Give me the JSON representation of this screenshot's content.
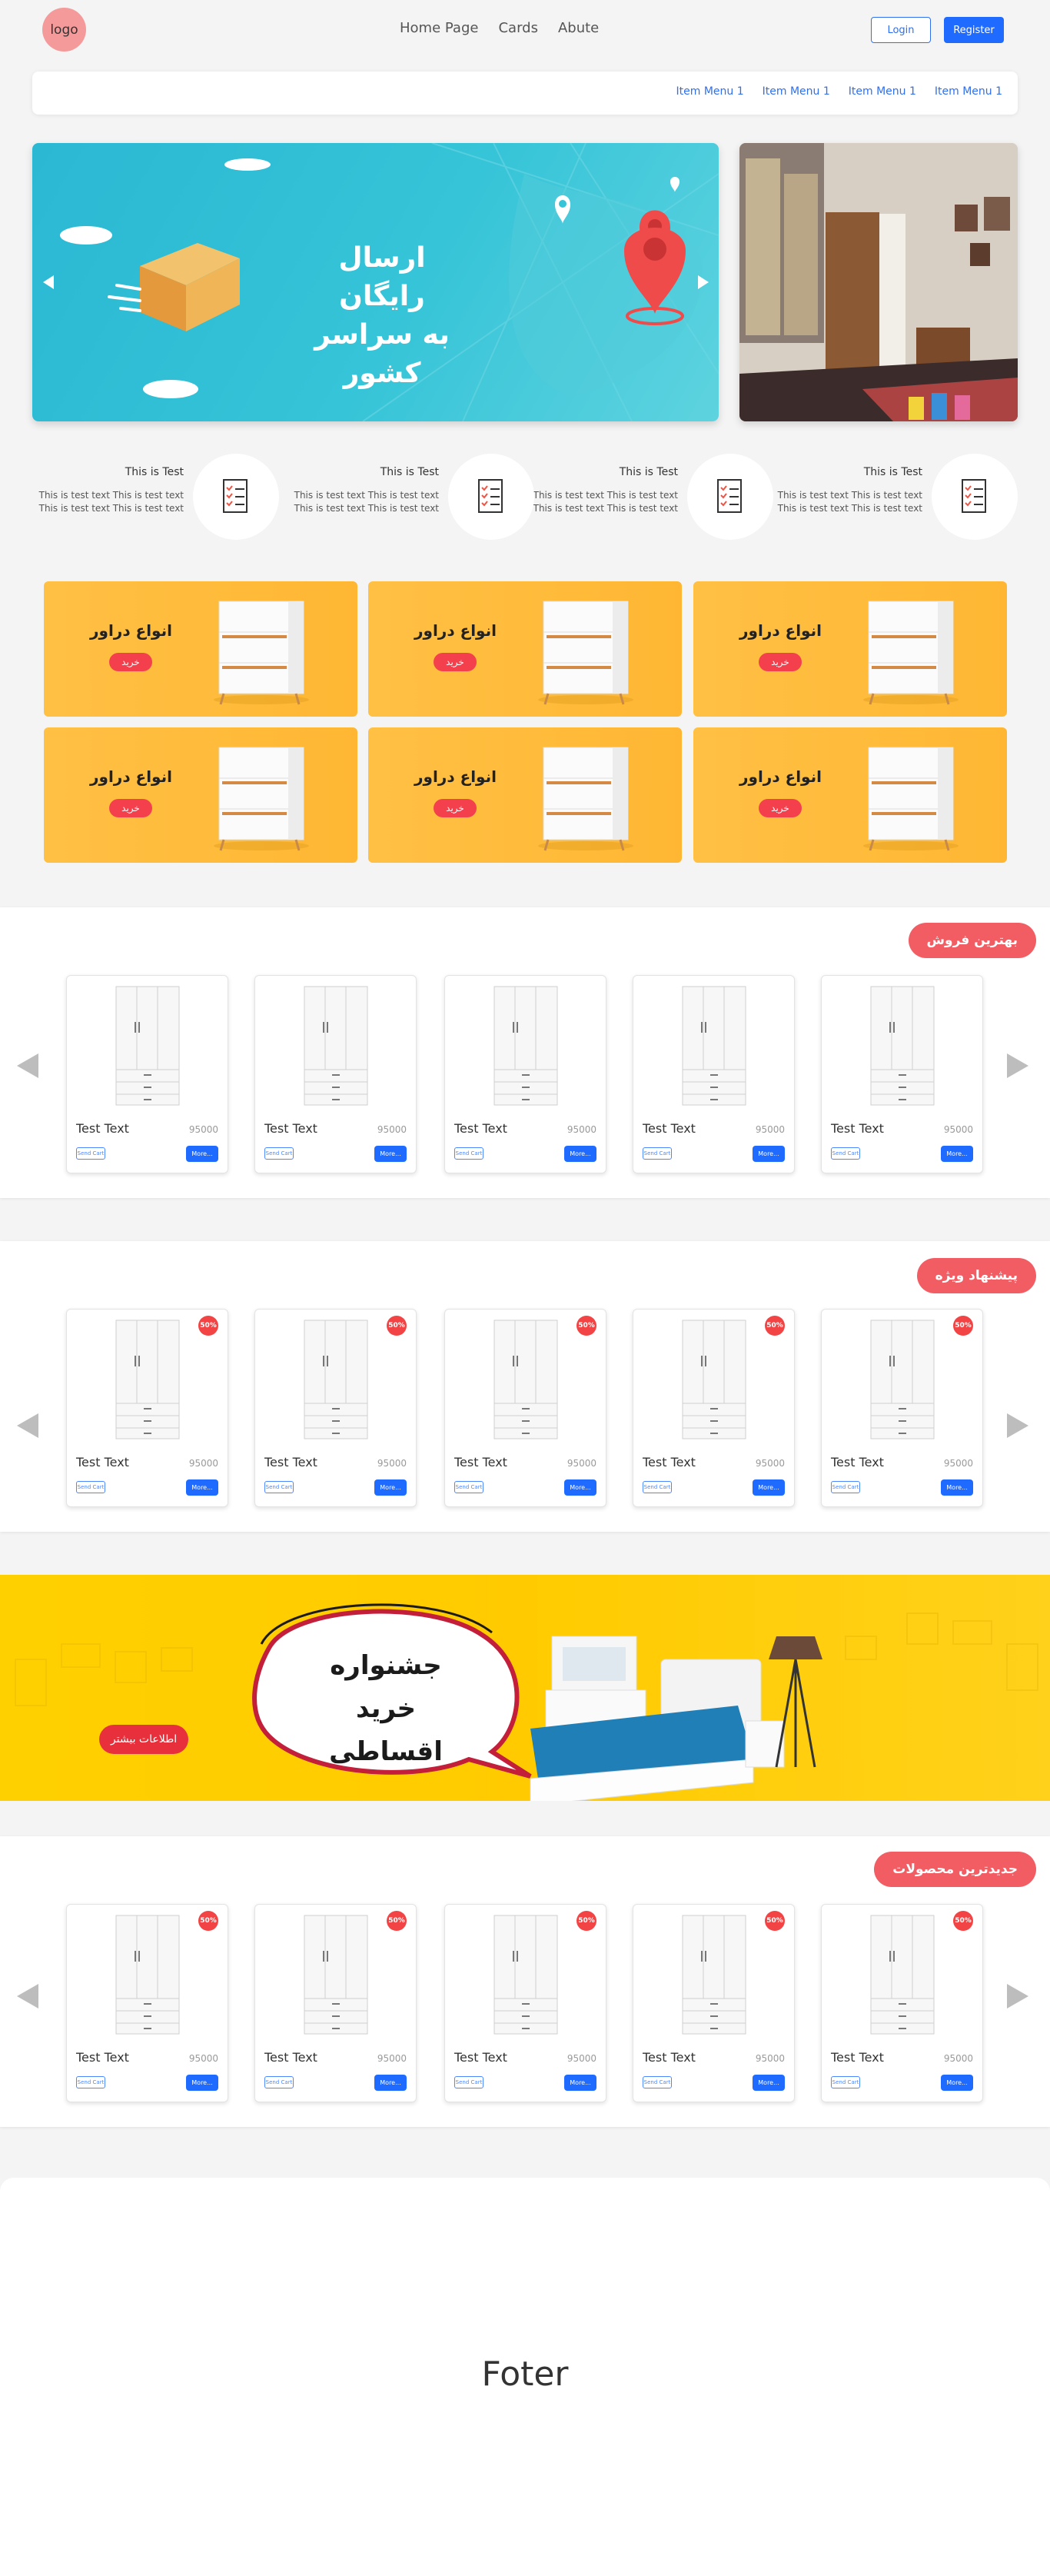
{
  "header": {
    "logo_text": "logo",
    "nav": [
      "Home Page",
      "Cards",
      "Abute"
    ],
    "login_label": "Login",
    "register_label": "Register"
  },
  "menu": [
    "Item Menu 1",
    "Item Menu 1",
    "Item Menu 1",
    "Item Menu 1"
  ],
  "hero": {
    "title_line1": "ارسال رایگان",
    "title_line2": "به سراسر کشور"
  },
  "features": [
    {
      "title": "This is Test",
      "text": "This is test text This is test text This is test text This is test text"
    },
    {
      "title": "This is Test",
      "text": "This is test text This is test text This is test text This is test text"
    },
    {
      "title": "This is Test",
      "text": "This is test text This is test text This is test text This is test text"
    },
    {
      "title": "This is Test",
      "text": "This is test text This is test text This is test text This is test text"
    }
  ],
  "categories": [
    {
      "title": "انواع دراور",
      "button": "خرید"
    },
    {
      "title": "انواع دراور",
      "button": "خرید"
    },
    {
      "title": "انواع دراور",
      "button": "خرید"
    },
    {
      "title": "انواع دراور",
      "button": "خرید"
    },
    {
      "title": "انواع دراور",
      "button": "خرید"
    },
    {
      "title": "انواع دراور",
      "button": "خرید"
    }
  ],
  "sections": [
    {
      "title": "بهترین فروش",
      "products": [
        {
          "name": "Test Text",
          "price": "95000",
          "secondary": "Send Cart",
          "more": "More..."
        },
        {
          "name": "Test Text",
          "price": "95000",
          "secondary": "Send Cart",
          "more": "More..."
        },
        {
          "name": "Test Text",
          "price": "95000",
          "secondary": "Send Cart",
          "more": "More..."
        },
        {
          "name": "Test Text",
          "price": "95000",
          "secondary": "Send Cart",
          "more": "More..."
        },
        {
          "name": "Test Text",
          "price": "95000",
          "secondary": "Send Cart",
          "more": "More..."
        }
      ]
    },
    {
      "title": "پیشنهاد ویژه",
      "products": [
        {
          "name": "Test Text",
          "price": "95000",
          "badge": "50%",
          "secondary": "Send Cart",
          "more": "More..."
        },
        {
          "name": "Test Text",
          "price": "95000",
          "badge": "50%",
          "secondary": "Send Cart",
          "more": "More..."
        },
        {
          "name": "Test Text",
          "price": "95000",
          "badge": "50%",
          "secondary": "Send Cart",
          "more": "More..."
        },
        {
          "name": "Test Text",
          "price": "95000",
          "badge": "50%",
          "secondary": "Send Cart",
          "more": "More..."
        },
        {
          "name": "Test Text",
          "price": "95000",
          "badge": "50%",
          "secondary": "Send Cart",
          "more": "More..."
        }
      ]
    },
    {
      "title": "جدیدترین محصولات",
      "products": [
        {
          "name": "Test Text",
          "price": "95000",
          "badge": "50%",
          "secondary": "Send Cart",
          "more": "More..."
        },
        {
          "name": "Test Text",
          "price": "95000",
          "badge": "50%",
          "secondary": "Send Cart",
          "more": "More..."
        },
        {
          "name": "Test Text",
          "price": "95000",
          "badge": "50%",
          "secondary": "Send Cart",
          "more": "More..."
        },
        {
          "name": "Test Text",
          "price": "95000",
          "badge": "50%",
          "secondary": "Send Cart",
          "more": "More..."
        },
        {
          "name": "Test Text",
          "price": "95000",
          "badge": "50%",
          "secondary": "Send Cart",
          "more": "More..."
        }
      ]
    }
  ],
  "banner": {
    "line1": "جشنواره خرید",
    "line2": "اقساطی",
    "button": "اطلاعات بیشتر"
  },
  "footer": {
    "text": "Foter"
  },
  "colors": {
    "accent": "#1f6bff",
    "section_pill": "#f25c63",
    "badge": "#f24444",
    "category_bg": "#ffbb3a",
    "banner_bg": "#ffcd00"
  }
}
